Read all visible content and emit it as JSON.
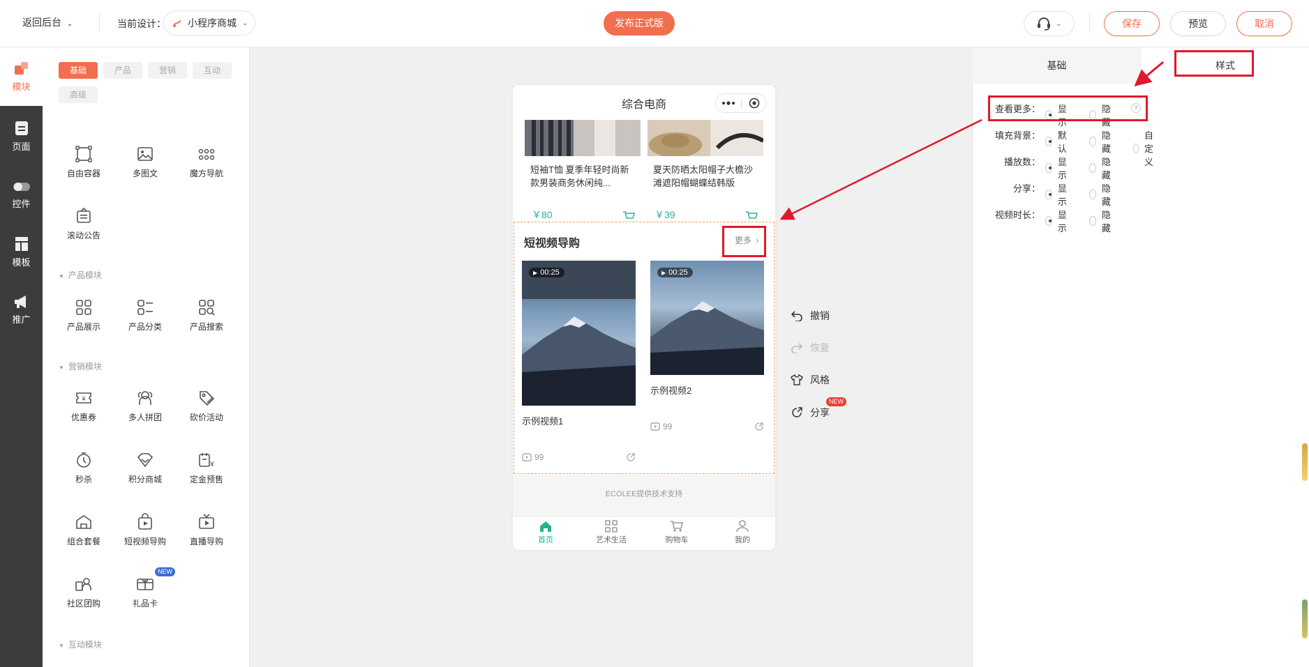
{
  "topbar": {
    "back_label": "返回后台",
    "current_design_label": "当前设计：",
    "design_name": "小程序商城",
    "publish_label": "发布正式版",
    "save_label": "保存",
    "preview_label": "预览",
    "cancel_label": "取消"
  },
  "rail": {
    "items": [
      {
        "label": "模块",
        "icon": "module-icon"
      },
      {
        "label": "页面",
        "icon": "page-icon"
      },
      {
        "label": "控件",
        "icon": "toggle-icon"
      },
      {
        "label": "模板",
        "icon": "template-icon"
      },
      {
        "label": "推广",
        "icon": "megaphone-icon"
      }
    ]
  },
  "panel": {
    "tabs": [
      "基础",
      "产品",
      "营销",
      "互动",
      "高级"
    ],
    "basic": [
      "自由容器",
      "多图文",
      "魔方导航",
      "滚动公告"
    ],
    "product_section": "产品模块",
    "product": [
      "产品展示",
      "产品分类",
      "产品搜索"
    ],
    "marketing_section": "营销模块",
    "marketing": [
      "优惠券",
      "多人拼团",
      "砍价活动",
      "秒杀",
      "积分商城",
      "定金预售",
      "组合套餐",
      "短视频导购",
      "直播导购",
      "社区团购",
      "礼品卡"
    ],
    "new_badge": "NEW",
    "interactive_section": "互动模块"
  },
  "phone": {
    "title": "综合电商",
    "products": [
      {
        "name": "短袖T恤 夏季年轻时尚新款男装商务休闲纯...",
        "price": "￥80"
      },
      {
        "name": "夏天防晒太阳帽子大檐沙滩遮阳帽蝴蝶结韩版",
        "price": "￥39"
      }
    ],
    "video_section": {
      "title": "短视频导购",
      "more": "更多",
      "videos": [
        {
          "duration": "00:25",
          "name": "示例视频1",
          "plays": "99"
        },
        {
          "duration": "00:25",
          "name": "示例视频2",
          "plays": "99"
        }
      ]
    },
    "support": "ECOLEE提供技术支持",
    "tabbar": [
      "首页",
      "艺术生活",
      "购物车",
      "我的"
    ]
  },
  "tools": {
    "undo": "撤销",
    "redo": "恢复",
    "style": "风格",
    "share": "分享",
    "new_badge": "NEW"
  },
  "settings": {
    "tabs": {
      "basic": "基础",
      "style": "样式"
    },
    "rows": [
      {
        "label": "查看更多：",
        "options": [
          "显示",
          "隐藏"
        ],
        "selected": 0
      },
      {
        "label": "填充背景：",
        "options": [
          "默认",
          "隐藏",
          "自定义"
        ],
        "selected": 0
      },
      {
        "label": "播放数：",
        "options": [
          "显示",
          "隐藏"
        ],
        "selected": 0
      },
      {
        "label": "分享：",
        "options": [
          "显示",
          "隐藏"
        ],
        "selected": 0
      },
      {
        "label": "视频时长：",
        "options": [
          "显示",
          "隐藏"
        ],
        "selected": 0
      }
    ],
    "help": "?"
  },
  "colors": {
    "accent": "#f36e4f",
    "price_green": "#2bb58a",
    "tab_active": "#1fb58f",
    "annotation_red": "#e0182b"
  }
}
